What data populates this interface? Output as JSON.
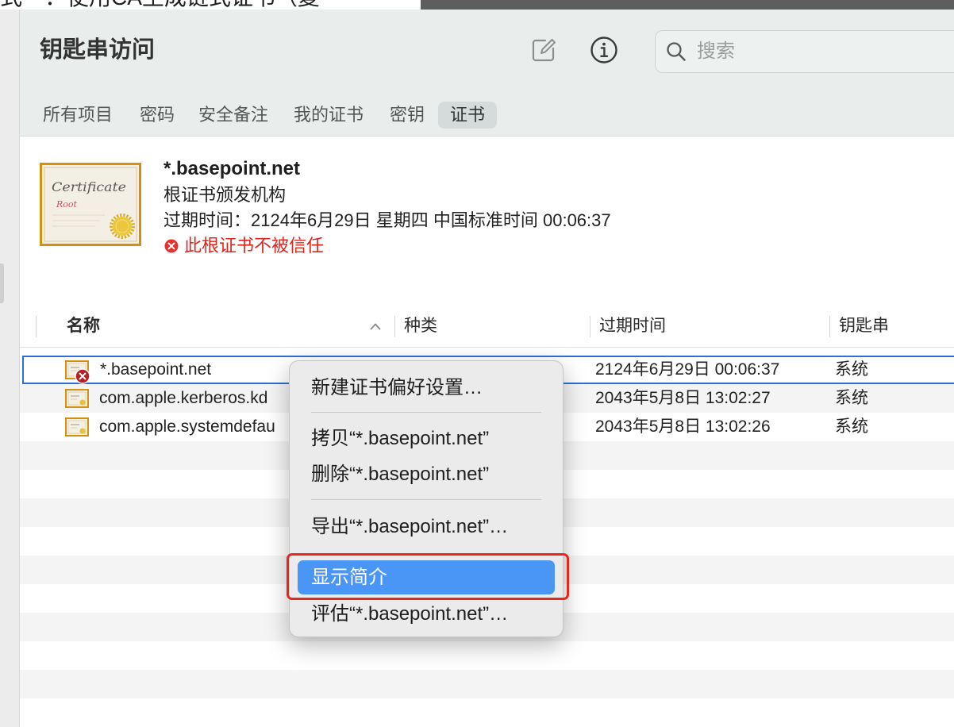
{
  "background_window": {
    "tab_text": "式　：使用CA生成链式证书（复"
  },
  "window": {
    "title": "钥匙串访问"
  },
  "toolbar": {
    "compose_icon": "compose-icon",
    "info_icon": "info-icon",
    "search": {
      "icon": "search-icon",
      "placeholder": "搜索",
      "value": ""
    }
  },
  "tabs": [
    {
      "label": "所有项目",
      "selected": false
    },
    {
      "label": "密码",
      "selected": false
    },
    {
      "label": "安全备注",
      "selected": false
    },
    {
      "label": "我的证书",
      "selected": false
    },
    {
      "label": "密钥",
      "selected": false
    },
    {
      "label": "证书",
      "selected": true
    }
  ],
  "detail": {
    "icon": "certificate-icon",
    "icon_lettering": {
      "line1": "Certificate",
      "line2": "Root"
    },
    "name": "*.basepoint.net",
    "kind": "根证书颁发机构",
    "expiry": "过期时间：2124年6月29日 星期四 中国标准时间 00:06:37",
    "trust_icon": "error-circle-icon",
    "trust_status": "此根证书不被信任"
  },
  "table": {
    "columns": [
      {
        "label": "名称",
        "sorted": true,
        "sort_ascending": true
      },
      {
        "label": "种类"
      },
      {
        "label": "过期时间"
      },
      {
        "label": "钥匙串"
      }
    ],
    "rows": [
      {
        "icon": "certificate-icon",
        "untrusted": true,
        "selected": true,
        "name": "*.basepoint.net",
        "expiry": "2124年6月29日 00:06:37",
        "keychain": "系统"
      },
      {
        "icon": "certificate-icon",
        "name": "com.apple.kerberos.kd",
        "expiry": "2043年5月8日 13:02:27",
        "keychain": "系统"
      },
      {
        "icon": "certificate-icon",
        "name": "com.apple.systemdefau",
        "expiry": "2043年5月8日 13:02:26",
        "keychain": "系统"
      }
    ]
  },
  "context_menu": {
    "items": [
      {
        "label": "新建证书偏好设置…"
      },
      {
        "separator": true
      },
      {
        "label": "拷贝“*.basepoint.net”"
      },
      {
        "label": "删除“*.basepoint.net”"
      },
      {
        "separator": true
      },
      {
        "label": "导出“*.basepoint.net”…"
      },
      {
        "separator": true
      },
      {
        "label": "显示简介",
        "highlighted": true
      },
      {
        "label": "评估“*.basepoint.net”…"
      }
    ]
  },
  "colors": {
    "accent": "#4a96f7",
    "focus_ring": "#2c6fd6",
    "untrusted": "#e0261c",
    "annotation": "#e8261e",
    "toolbar_bg": "#e9eeed"
  }
}
